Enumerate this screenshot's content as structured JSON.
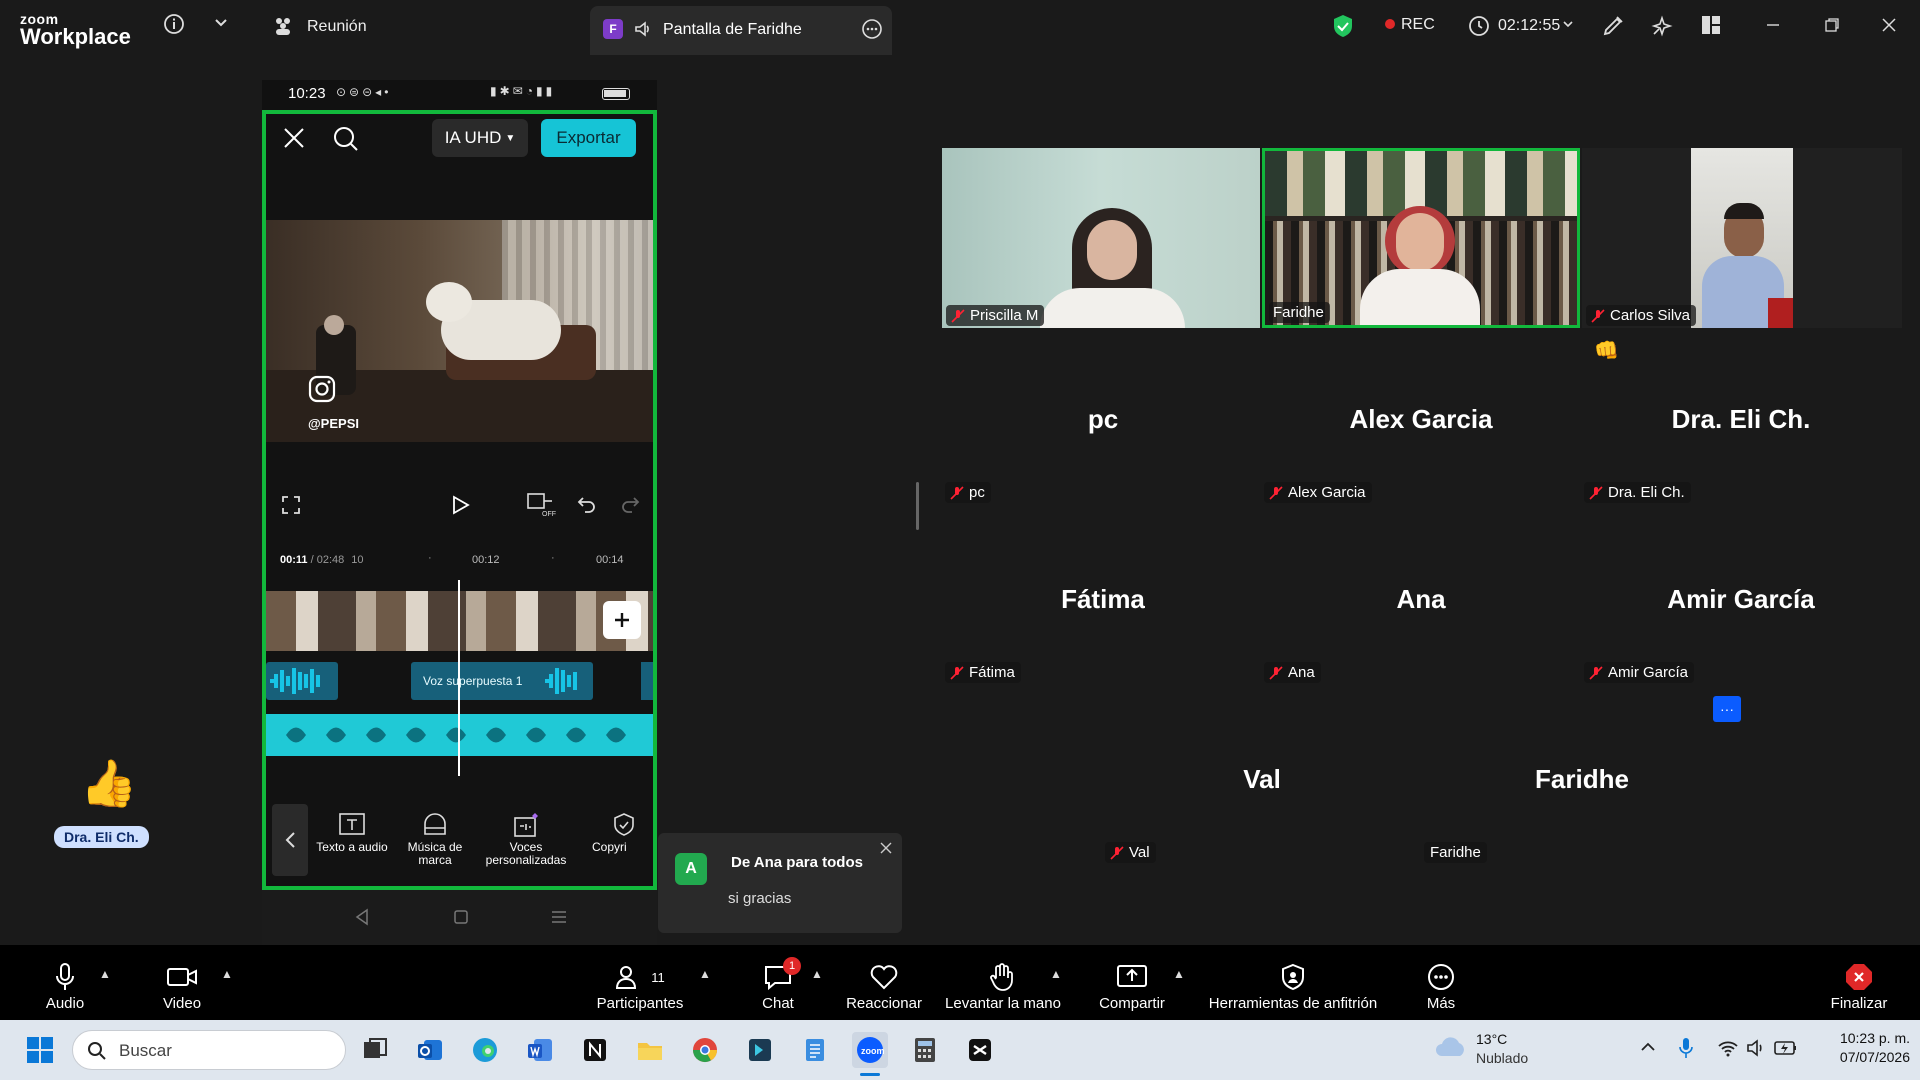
{
  "app": {
    "brand_line1": "zoom",
    "brand_line2": "Workplace"
  },
  "topbar": {
    "meeting_label": "Reunión",
    "share_tab_badge": "F",
    "share_tab_label": "Pantalla de Faridhe",
    "rec_label": "REC",
    "timer": "02:12:55"
  },
  "phone": {
    "time": "10:23",
    "quality_label": "IA UHD",
    "export_label": "Exportar",
    "watermark": "@PEPSI",
    "time_current": "00:11",
    "time_total": "/ 02:48",
    "tick_a": "10",
    "tick_b": "00:12",
    "tick_c": "00:14",
    "voice_track_label": "Voz superpuesta 1",
    "tools": [
      {
        "label": "Texto a audio",
        "icon": "text-to-audio-icon"
      },
      {
        "label": "Música de marca",
        "icon": "brand-music-icon"
      },
      {
        "label": "Voces personalizadas",
        "icon": "custom-voices-icon"
      },
      {
        "label": "Copyri",
        "icon": "copyright-icon"
      }
    ]
  },
  "video_tiles": [
    {
      "name": "Priscilla M"
    },
    {
      "name": "Faridhe"
    },
    {
      "name": "Carlos Silva"
    }
  ],
  "participants": [
    {
      "big": "pc",
      "chip": "pc"
    },
    {
      "big": "Alex Garcia",
      "chip": "Alex Garcia"
    },
    {
      "big": "Dra. Eli Ch.",
      "chip": "Dra. Eli Ch."
    },
    {
      "big": "Fátima",
      "chip": "Fátima"
    },
    {
      "big": "Ana",
      "chip": "Ana"
    },
    {
      "big": "Amir García",
      "chip": "Amir García"
    },
    {
      "big": "Val",
      "chip": "Val"
    },
    {
      "big": "Faridhe",
      "chip": "Faridhe"
    }
  ],
  "reaction": {
    "emoji": "👍",
    "name": "Dra. Eli Ch."
  },
  "notification": {
    "avatar": "A",
    "title": "De Ana para todos",
    "message": "si gracias"
  },
  "toolbar": {
    "audio": "Audio",
    "video": "Video",
    "participants": "Participantes",
    "participants_count": "11",
    "chat": "Chat",
    "chat_badge": "1",
    "react": "Reaccionar",
    "raise_hand": "Levantar la mano",
    "share": "Compartir",
    "host_tools": "Herramientas de anfitrión",
    "more": "Más",
    "end": "Finalizar"
  },
  "taskbar": {
    "search_placeholder": "Buscar",
    "weather_temp": "13°C",
    "weather_desc": "Nublado",
    "clock_time": "10:23 p. m.",
    "clock_date": "07/07/2026"
  },
  "colors": {
    "accent_green": "#12b83c",
    "teal": "#16c4d6",
    "zoom_blue": "#0b5cff",
    "end_red": "#e02828"
  }
}
